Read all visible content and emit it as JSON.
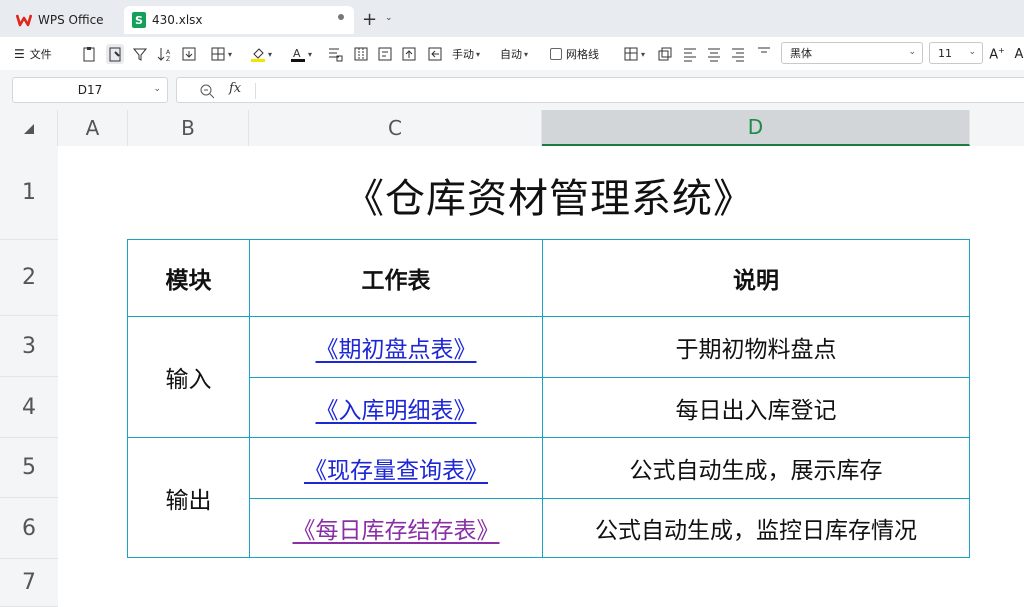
{
  "tabs": {
    "app_label": "WPS Office",
    "file_label": "430.xlsx",
    "file_icon": "S"
  },
  "toolbar": {
    "menu_label": "文件",
    "wrap_label": "手动",
    "auto_label": "自动",
    "gridlines_label": "网格线",
    "font_name": "黑体",
    "font_size": "11"
  },
  "formula_bar": {
    "cell_ref": "D17",
    "fx_symbol": "fx",
    "content": ""
  },
  "columns": [
    "A",
    "B",
    "C",
    "D"
  ],
  "rows": [
    "1",
    "2",
    "3",
    "4",
    "5",
    "6",
    "7"
  ],
  "selected_column": "D",
  "sheet": {
    "title": "《仓库资材管理系统》",
    "headers": [
      "模块",
      "工作表",
      "说明"
    ],
    "groups": [
      {
        "module": "输入"
      },
      {
        "module": "输出"
      }
    ],
    "entries": [
      {
        "sheet": "《期初盘点表》",
        "desc": "于期初物料盘点"
      },
      {
        "sheet": "《入库明细表》",
        "desc": "每日出入库登记"
      },
      {
        "sheet": "《现存量查询表》",
        "desc": "公式自动生成，展示库存"
      },
      {
        "sheet": "《每日库存结存表》",
        "desc": "公式自动生成，监控日库存情况"
      }
    ]
  },
  "colors": {
    "table_border": "#18a3c6",
    "link": "#1d27d6",
    "visited_link": "#8a2fa6",
    "selected_header_text": "#1e8a4b"
  }
}
